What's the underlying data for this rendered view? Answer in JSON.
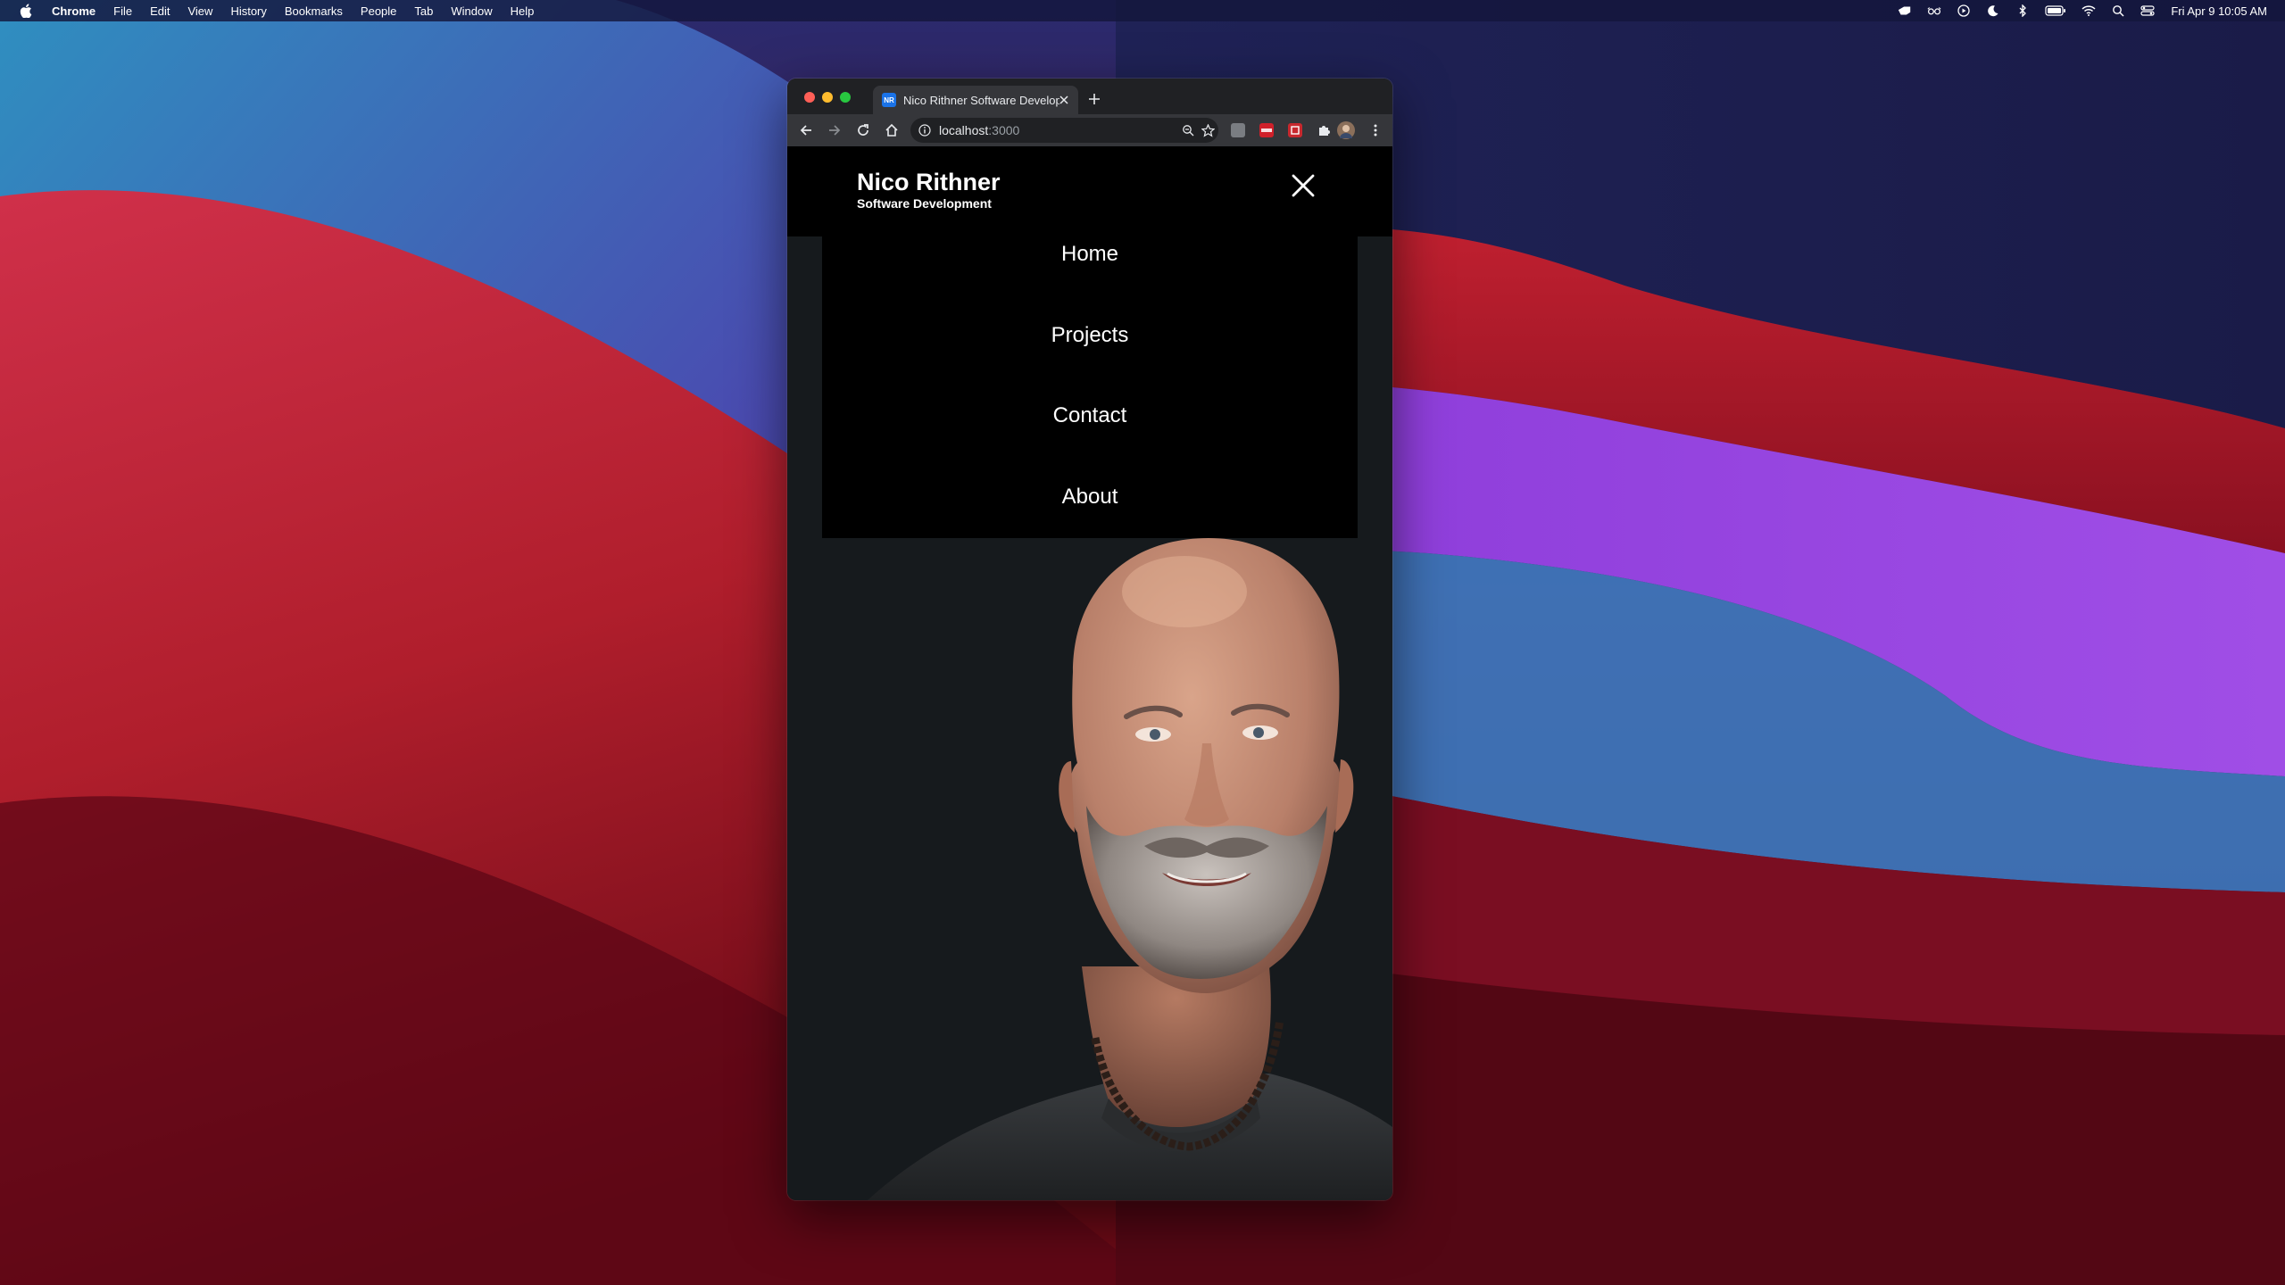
{
  "menubar": {
    "app_name": "Chrome",
    "menus": [
      "File",
      "Edit",
      "View",
      "History",
      "Bookmarks",
      "People",
      "Tab",
      "Window",
      "Help"
    ],
    "status_icons": [
      "notification-hand-icon",
      "glasses-icon",
      "play-circle-icon",
      "moon-icon",
      "bluetooth-icon",
      "battery-icon",
      "wifi-icon",
      "spotlight-search-icon",
      "control-center-icon"
    ],
    "clock": "Fri Apr 9  10:05 AM"
  },
  "browser": {
    "tab": {
      "favicon_text": "NR",
      "title": "Nico Rithner Software Develop"
    },
    "address": {
      "host": "localhost",
      "port": ":3000"
    },
    "extensions": [
      "extension-gray-icon",
      "extension-red-icon",
      "extension-red-box-icon",
      "puzzle-icon",
      "profile-avatar-icon"
    ]
  },
  "site": {
    "header": {
      "name": "Nico Rithner",
      "tagline": "Software Development"
    },
    "nav": [
      {
        "label": "Home"
      },
      {
        "label": "Projects"
      },
      {
        "label": "Contact"
      },
      {
        "label": "About"
      }
    ],
    "portrait_alt": "portrait-photo"
  },
  "colors": {
    "page_background": "#161a1d",
    "header_background": "#000000",
    "nav_text": "#ffffff",
    "browser_tabstrip": "#202124",
    "browser_toolbar": "#35363a"
  }
}
